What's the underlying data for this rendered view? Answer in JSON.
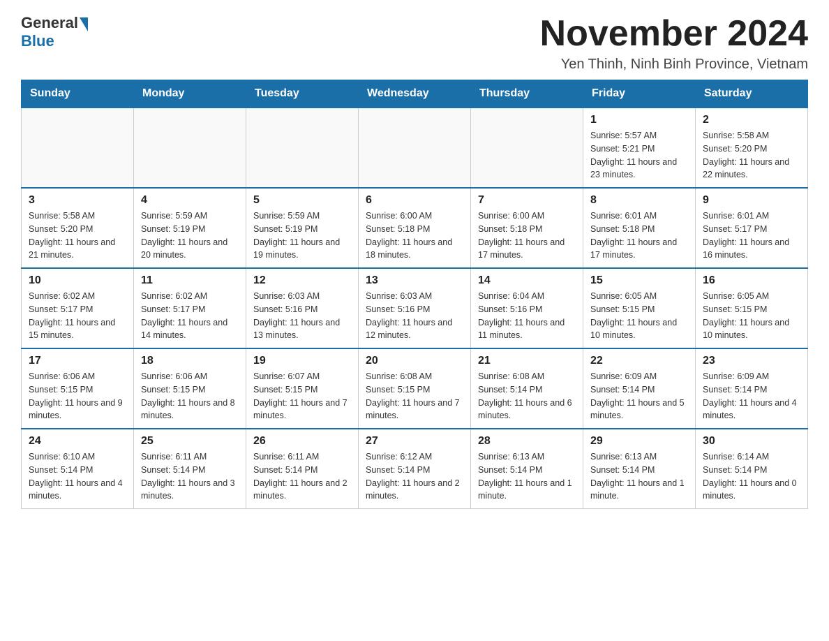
{
  "logo": {
    "general": "General",
    "arrow": "",
    "blue": "Blue"
  },
  "title": {
    "month_year": "November 2024",
    "location": "Yen Thinh, Ninh Binh Province, Vietnam"
  },
  "weekdays": [
    "Sunday",
    "Monday",
    "Tuesday",
    "Wednesday",
    "Thursday",
    "Friday",
    "Saturday"
  ],
  "weeks": [
    {
      "days": [
        {
          "number": "",
          "info": ""
        },
        {
          "number": "",
          "info": ""
        },
        {
          "number": "",
          "info": ""
        },
        {
          "number": "",
          "info": ""
        },
        {
          "number": "",
          "info": ""
        },
        {
          "number": "1",
          "info": "Sunrise: 5:57 AM\nSunset: 5:21 PM\nDaylight: 11 hours and 23 minutes."
        },
        {
          "number": "2",
          "info": "Sunrise: 5:58 AM\nSunset: 5:20 PM\nDaylight: 11 hours and 22 minutes."
        }
      ]
    },
    {
      "days": [
        {
          "number": "3",
          "info": "Sunrise: 5:58 AM\nSunset: 5:20 PM\nDaylight: 11 hours and 21 minutes."
        },
        {
          "number": "4",
          "info": "Sunrise: 5:59 AM\nSunset: 5:19 PM\nDaylight: 11 hours and 20 minutes."
        },
        {
          "number": "5",
          "info": "Sunrise: 5:59 AM\nSunset: 5:19 PM\nDaylight: 11 hours and 19 minutes."
        },
        {
          "number": "6",
          "info": "Sunrise: 6:00 AM\nSunset: 5:18 PM\nDaylight: 11 hours and 18 minutes."
        },
        {
          "number": "7",
          "info": "Sunrise: 6:00 AM\nSunset: 5:18 PM\nDaylight: 11 hours and 17 minutes."
        },
        {
          "number": "8",
          "info": "Sunrise: 6:01 AM\nSunset: 5:18 PM\nDaylight: 11 hours and 17 minutes."
        },
        {
          "number": "9",
          "info": "Sunrise: 6:01 AM\nSunset: 5:17 PM\nDaylight: 11 hours and 16 minutes."
        }
      ]
    },
    {
      "days": [
        {
          "number": "10",
          "info": "Sunrise: 6:02 AM\nSunset: 5:17 PM\nDaylight: 11 hours and 15 minutes."
        },
        {
          "number": "11",
          "info": "Sunrise: 6:02 AM\nSunset: 5:17 PM\nDaylight: 11 hours and 14 minutes."
        },
        {
          "number": "12",
          "info": "Sunrise: 6:03 AM\nSunset: 5:16 PM\nDaylight: 11 hours and 13 minutes."
        },
        {
          "number": "13",
          "info": "Sunrise: 6:03 AM\nSunset: 5:16 PM\nDaylight: 11 hours and 12 minutes."
        },
        {
          "number": "14",
          "info": "Sunrise: 6:04 AM\nSunset: 5:16 PM\nDaylight: 11 hours and 11 minutes."
        },
        {
          "number": "15",
          "info": "Sunrise: 6:05 AM\nSunset: 5:15 PM\nDaylight: 11 hours and 10 minutes."
        },
        {
          "number": "16",
          "info": "Sunrise: 6:05 AM\nSunset: 5:15 PM\nDaylight: 11 hours and 10 minutes."
        }
      ]
    },
    {
      "days": [
        {
          "number": "17",
          "info": "Sunrise: 6:06 AM\nSunset: 5:15 PM\nDaylight: 11 hours and 9 minutes."
        },
        {
          "number": "18",
          "info": "Sunrise: 6:06 AM\nSunset: 5:15 PM\nDaylight: 11 hours and 8 minutes."
        },
        {
          "number": "19",
          "info": "Sunrise: 6:07 AM\nSunset: 5:15 PM\nDaylight: 11 hours and 7 minutes."
        },
        {
          "number": "20",
          "info": "Sunrise: 6:08 AM\nSunset: 5:15 PM\nDaylight: 11 hours and 7 minutes."
        },
        {
          "number": "21",
          "info": "Sunrise: 6:08 AM\nSunset: 5:14 PM\nDaylight: 11 hours and 6 minutes."
        },
        {
          "number": "22",
          "info": "Sunrise: 6:09 AM\nSunset: 5:14 PM\nDaylight: 11 hours and 5 minutes."
        },
        {
          "number": "23",
          "info": "Sunrise: 6:09 AM\nSunset: 5:14 PM\nDaylight: 11 hours and 4 minutes."
        }
      ]
    },
    {
      "days": [
        {
          "number": "24",
          "info": "Sunrise: 6:10 AM\nSunset: 5:14 PM\nDaylight: 11 hours and 4 minutes."
        },
        {
          "number": "25",
          "info": "Sunrise: 6:11 AM\nSunset: 5:14 PM\nDaylight: 11 hours and 3 minutes."
        },
        {
          "number": "26",
          "info": "Sunrise: 6:11 AM\nSunset: 5:14 PM\nDaylight: 11 hours and 2 minutes."
        },
        {
          "number": "27",
          "info": "Sunrise: 6:12 AM\nSunset: 5:14 PM\nDaylight: 11 hours and 2 minutes."
        },
        {
          "number": "28",
          "info": "Sunrise: 6:13 AM\nSunset: 5:14 PM\nDaylight: 11 hours and 1 minute."
        },
        {
          "number": "29",
          "info": "Sunrise: 6:13 AM\nSunset: 5:14 PM\nDaylight: 11 hours and 1 minute."
        },
        {
          "number": "30",
          "info": "Sunrise: 6:14 AM\nSunset: 5:14 PM\nDaylight: 11 hours and 0 minutes."
        }
      ]
    }
  ]
}
